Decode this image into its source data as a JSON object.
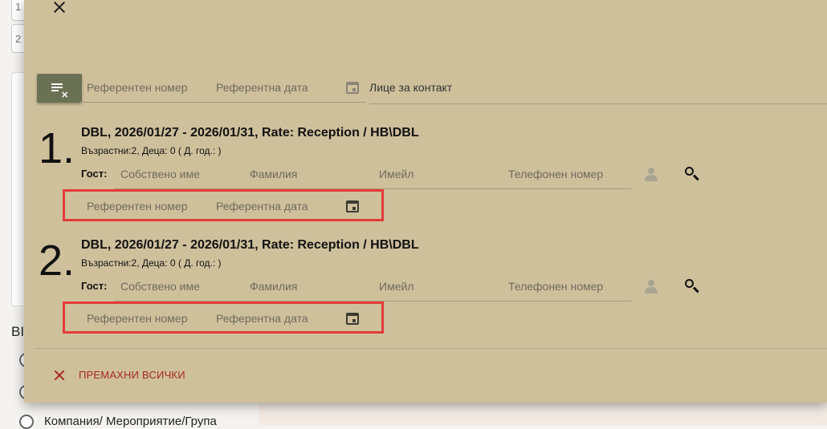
{
  "background": {
    "input_1_value": "1",
    "input_2_value": "2",
    "heading": "ВІ",
    "radio_label": "Компания/ Мероприятие/Група"
  },
  "dialog": {
    "search_bar": {
      "reference_number_placeholder": "Референтен номер",
      "reference_date_placeholder": "Референтна дата",
      "contact_person_label": "Лице за контакт"
    },
    "rooms": [
      {
        "index": "1.",
        "title": "DBL, 2026/01/27 - 2026/01/31, Rate: Reception / HB\\DBL",
        "subtitle": "Възрастни:2, Деца: 0 ( Д. год.: )",
        "guest_label": "Гост:",
        "first_name_placeholder": "Собствено име",
        "last_name_placeholder": "Фамилия",
        "email_placeholder": "Имейл",
        "phone_placeholder": "Телефонен номер",
        "reference_number_placeholder": "Референтен номер",
        "reference_date_placeholder": "Референтна дата"
      },
      {
        "index": "2.",
        "title": "DBL, 2026/01/27 - 2026/01/31, Rate: Reception / HB\\DBL",
        "subtitle": "Възрастни:2, Деца: 0 ( Д. год.: )",
        "guest_label": "Гост:",
        "first_name_placeholder": "Собствено име",
        "last_name_placeholder": "Фамилия",
        "email_placeholder": "Имейл",
        "phone_placeholder": "Телефонен номер",
        "reference_number_placeholder": "Референтен номер",
        "reference_date_placeholder": "Референтна дата"
      }
    ],
    "remove_all_label": "ПРЕМАХНИ ВСИЧКИ"
  },
  "colors": {
    "dialog_bg": "#cfc09c",
    "clear_button": "#6b7155",
    "danger": "#a6291d",
    "highlight": "#e33b3b"
  },
  "icons": [
    "close-icon",
    "clear-filter-icon",
    "calendar-icon",
    "person-icon",
    "search-icon"
  ]
}
